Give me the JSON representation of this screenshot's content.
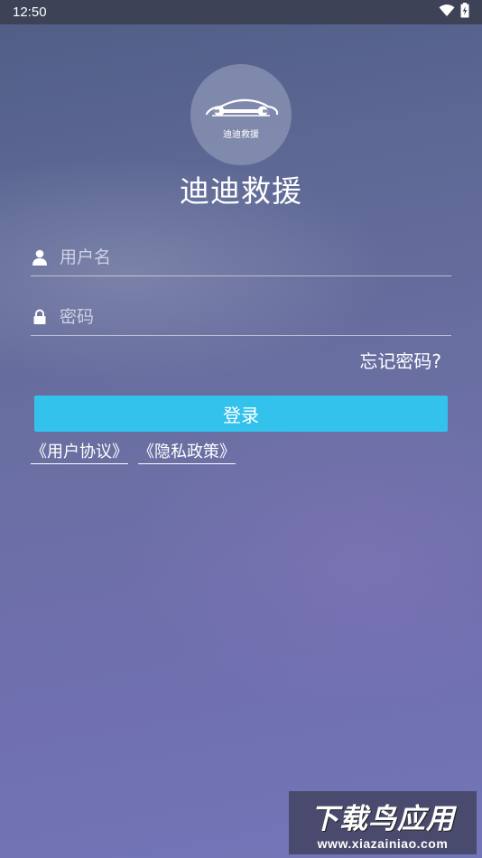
{
  "status_bar": {
    "time": "12:50",
    "icons": [
      "wifi-icon",
      "battery-charging-icon"
    ]
  },
  "logo": {
    "caption": "迪迪救援",
    "icon": "car-wrench-icon"
  },
  "app_title": "迪迪救援",
  "username": {
    "placeholder": "用户名",
    "value": "",
    "icon": "user-icon"
  },
  "password": {
    "placeholder": "密码",
    "value": "",
    "icon": "lock-icon"
  },
  "forgot_password": "忘记密码?",
  "login_button": "登录",
  "links": {
    "user_agreement": "《用户协议》",
    "privacy_policy": "《隐私政策》"
  },
  "watermark": {
    "title": "下载鸟应用",
    "url": "www.xiazainiao.com"
  },
  "colors": {
    "accent": "#33c2ec",
    "status_bar": "#3d4256"
  }
}
